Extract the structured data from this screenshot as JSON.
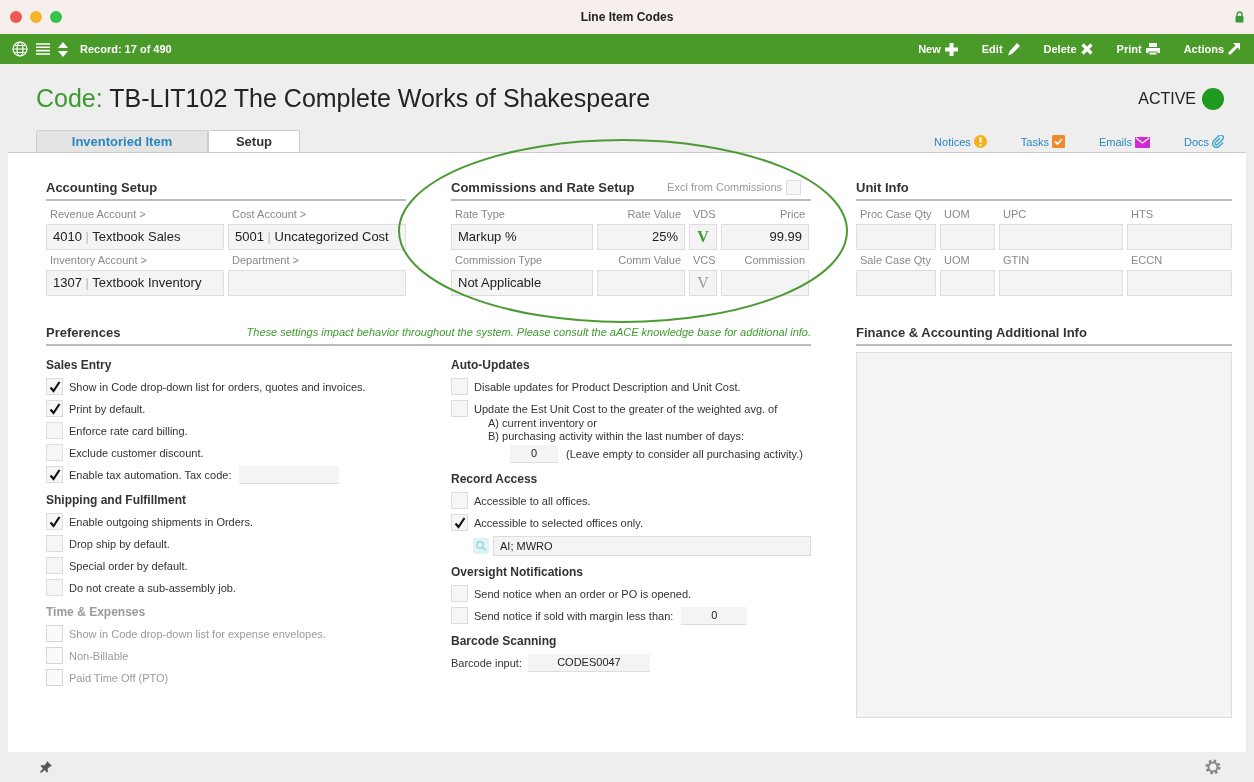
{
  "window": {
    "title": "Line Item Codes"
  },
  "toolbar": {
    "record": "Record: 17 of 490",
    "actions": [
      {
        "label": "New",
        "kind": "plus"
      },
      {
        "label": "Edit",
        "kind": "pencil"
      },
      {
        "label": "Delete",
        "kind": "x"
      },
      {
        "label": "Print",
        "kind": "printer"
      },
      {
        "label": "Actions",
        "kind": "arrow"
      }
    ]
  },
  "header": {
    "prefix": "Code:",
    "title": "TB-LIT102 The Complete Works of Shakespeare",
    "status": "ACTIVE"
  },
  "tabs": [
    {
      "label": "Inventoried Item",
      "selected": false
    },
    {
      "label": "Setup",
      "selected": true
    }
  ],
  "links": [
    {
      "label": "Notices",
      "kind": "alert"
    },
    {
      "label": "Tasks",
      "kind": "task"
    },
    {
      "label": "Emails",
      "kind": "mail"
    },
    {
      "label": "Docs",
      "kind": "clip"
    }
  ],
  "accounting": {
    "title": "Accounting Setup",
    "fields": [
      {
        "label": "Revenue Account >",
        "code": "4010",
        "separator": "|",
        "value": "Textbook Sales"
      },
      {
        "label": "Cost Account >",
        "code": "5001",
        "separator": "|",
        "value": "Uncategorized Cost"
      },
      {
        "label": "Inventory Account >",
        "code": "1307",
        "separator": "|",
        "value": "Textbook Inventory"
      },
      {
        "label": "Department >"
      }
    ]
  },
  "commissions": {
    "title": "Commissions and Rate Setup",
    "excl_label": "Excl from Commissions",
    "excl_checked": false,
    "rows": [
      [
        {
          "label": "Rate Type",
          "value": "Markup %",
          "kind": "text"
        },
        {
          "label": "Rate Value",
          "value": "25%",
          "kind": "num"
        },
        {
          "label": "VDS",
          "value": "V",
          "kind": "flag",
          "on": true
        },
        {
          "label": "Price",
          "value": "99.99",
          "kind": "num"
        }
      ],
      [
        {
          "label": "Commission Type",
          "value": "Not Applicable",
          "kind": "text"
        },
        {
          "label": "Comm Value",
          "kind": "num"
        },
        {
          "label": "VCS",
          "value": "V",
          "kind": "flag",
          "on": false
        },
        {
          "label": "Commission",
          "kind": "num"
        }
      ]
    ]
  },
  "unit_info": {
    "title": "Unit Info",
    "rows": [
      [
        "Proc Case Qty",
        "UOM",
        "UPC",
        "HTS"
      ],
      [
        "Sale Case Qty",
        "UOM",
        "GTIN",
        "ECCN"
      ]
    ]
  },
  "preferences": {
    "title": "Preferences",
    "note": "These settings impact behavior throughout the system. Please consult the aACE knowledge base for additional info.",
    "left": [
      {
        "title": "Sales Entry",
        "disabled": false,
        "items": [
          {
            "kind": "check",
            "label": "Show in Code drop-down list for orders, quotes and invoices.",
            "checked": true
          },
          {
            "kind": "check",
            "label": "Print by default.",
            "checked": true
          },
          {
            "kind": "check",
            "label": "Enforce rate card billing.",
            "checked": false
          },
          {
            "kind": "check",
            "label": "Exclude customer discount.",
            "checked": false
          },
          {
            "kind": "check_field",
            "label": "Enable tax automation. Tax code:",
            "checked": true
          }
        ]
      },
      {
        "title": "Shipping and Fulfillment",
        "disabled": false,
        "items": [
          {
            "kind": "check",
            "label": "Enable outgoing shipments in Orders.",
            "checked": true
          },
          {
            "kind": "check",
            "label": "Drop ship by default.",
            "checked": false
          },
          {
            "kind": "check",
            "label": "Special order by default.",
            "checked": false
          },
          {
            "kind": "check",
            "label": "Do not create a sub-assembly job.",
            "checked": false
          }
        ]
      },
      {
        "title": "Time & Expenses",
        "disabled": true,
        "items": [
          {
            "kind": "check",
            "label": "Show in Code drop-down list for expense envelopes.",
            "checked": false
          },
          {
            "kind": "check",
            "label": "Non-Billable",
            "checked": false
          },
          {
            "kind": "check",
            "label": "Paid Time Off (PTO)",
            "checked": false
          }
        ]
      }
    ],
    "right": [
      {
        "title": "Auto-Updates",
        "disabled": false,
        "items": [
          {
            "kind": "check",
            "label": "Disable updates for Product Description and Unit Cost.",
            "checked": false
          },
          {
            "kind": "check_multi",
            "label": "Update the Est Unit Cost to the greater of the weighted avg. of",
            "checked": false,
            "lines": [
              "A) current inventory or",
              "B) purchasing activity within the last number of days:"
            ],
            "value": "0",
            "note": "(Leave empty to consider all purchasing activity.)"
          }
        ]
      },
      {
        "title": "Record Access",
        "disabled": false,
        "items": [
          {
            "kind": "check",
            "label": "Accessible to all offices.",
            "checked": false
          },
          {
            "kind": "check",
            "label": "Accessible to selected offices only.",
            "checked": true
          },
          {
            "kind": "lookup",
            "value": "AI; MWRO"
          }
        ]
      },
      {
        "title": "Oversight Notifications",
        "disabled": false,
        "items": [
          {
            "kind": "check",
            "label": "Send notice when an order or PO is opened.",
            "checked": false
          },
          {
            "kind": "check_field",
            "label": "Send notice if sold with margin less than:",
            "checked": false,
            "value": "0"
          }
        ]
      },
      {
        "title": "Barcode Scanning",
        "disabled": false,
        "items": [
          {
            "kind": "labeled_field",
            "label": "Barcode input:",
            "value": "CODES0047"
          }
        ]
      }
    ]
  },
  "finance": {
    "title": "Finance & Accounting Additional Info"
  }
}
